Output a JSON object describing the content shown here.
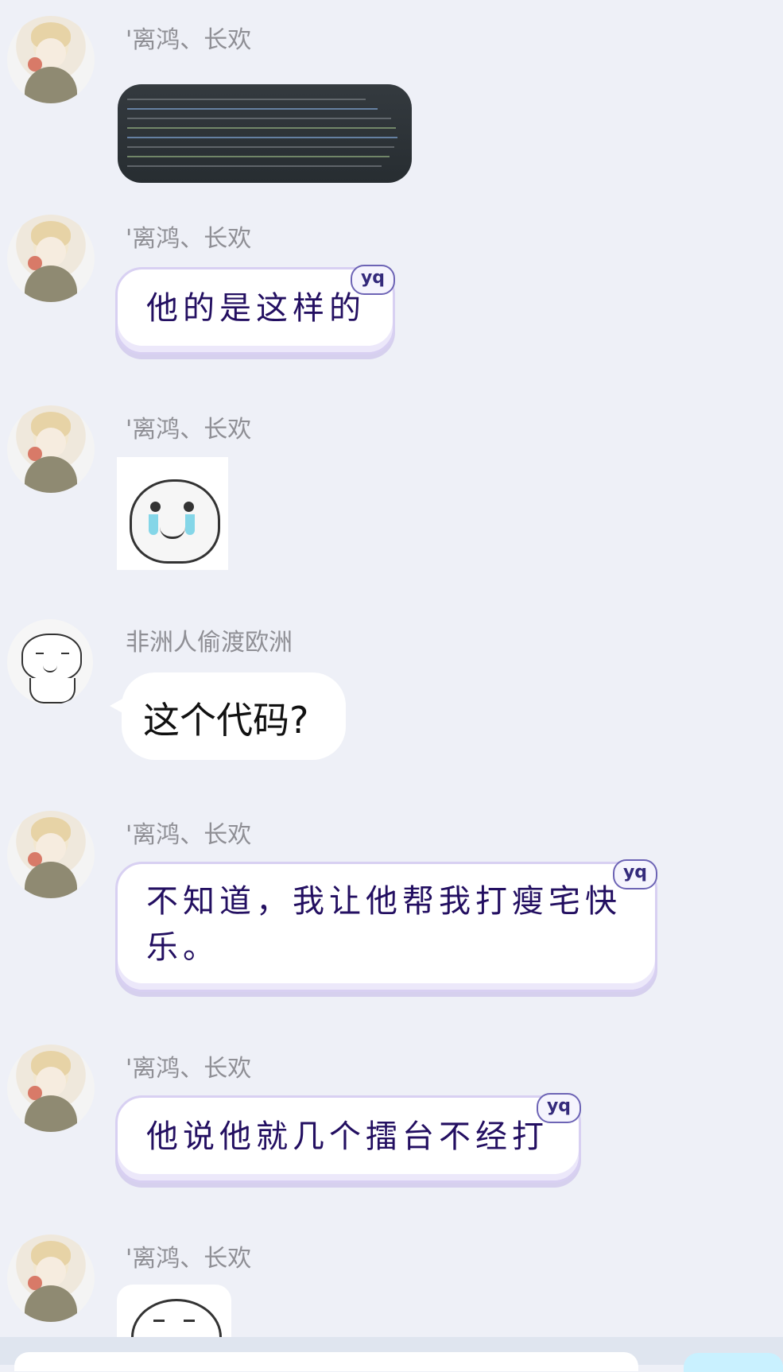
{
  "messages": [
    {
      "sender": "'离鸿、长欢",
      "type": "image"
    },
    {
      "sender": "'离鸿、长欢",
      "type": "text",
      "text": "他的是这样的",
      "badge": "yq"
    },
    {
      "sender": "'离鸿、长欢",
      "type": "sticker"
    },
    {
      "sender": "非洲人偷渡欧洲",
      "type": "text",
      "text": "这个代码?"
    },
    {
      "sender": "'离鸿、长欢",
      "type": "text",
      "text": "不知道，我让他帮我打瘦宅快乐。",
      "badge": "yq"
    },
    {
      "sender": "'离鸿、长欢",
      "type": "text",
      "text": "他说他就几个擂台不经打",
      "badge": "yq"
    },
    {
      "sender": "'离鸿、长欢",
      "type": "sticker"
    }
  ]
}
